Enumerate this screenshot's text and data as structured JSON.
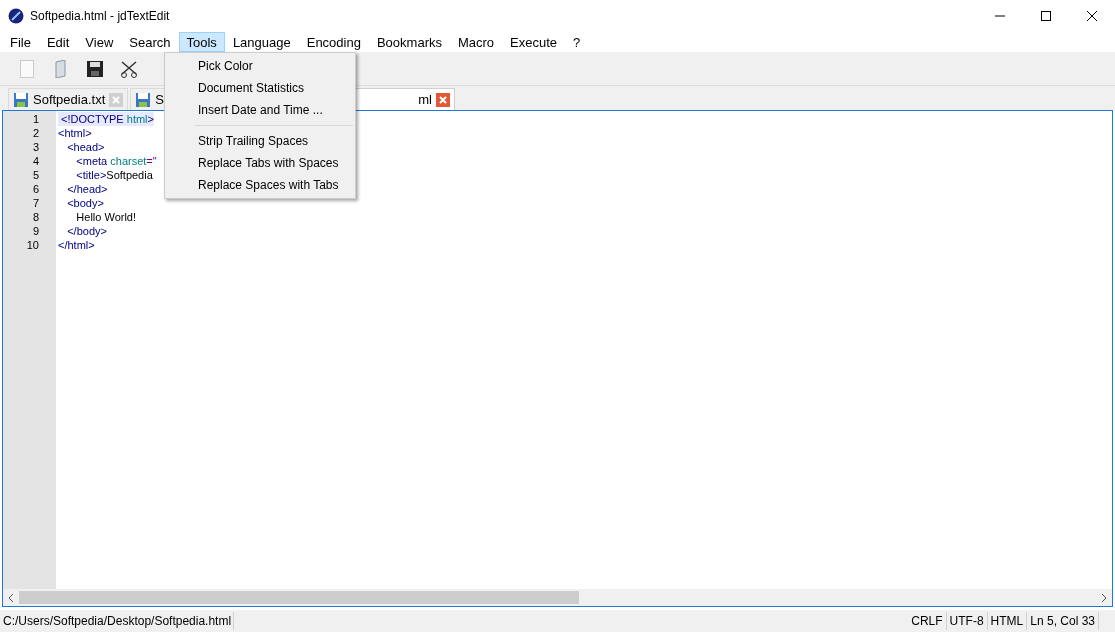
{
  "window": {
    "title": "Softpedia.html - jdTextEdit"
  },
  "menu": [
    {
      "label": "File",
      "selected": false
    },
    {
      "label": "Edit",
      "selected": false
    },
    {
      "label": "View",
      "selected": false
    },
    {
      "label": "Search",
      "selected": false
    },
    {
      "label": "Tools",
      "selected": true
    },
    {
      "label": "Language",
      "selected": false
    },
    {
      "label": "Encoding",
      "selected": false
    },
    {
      "label": "Bookmarks",
      "selected": false
    },
    {
      "label": "Macro",
      "selected": false
    },
    {
      "label": "Execute",
      "selected": false
    },
    {
      "label": "?",
      "selected": false
    }
  ],
  "dropdown": [
    {
      "kind": "item",
      "label": "Pick Color"
    },
    {
      "kind": "item",
      "label": "Document Statistics"
    },
    {
      "kind": "item",
      "label": "Insert Date and Time ..."
    },
    {
      "kind": "separator"
    },
    {
      "kind": "item",
      "label": "Strip Trailing Spaces"
    },
    {
      "kind": "item",
      "label": "Replace Tabs with Spaces"
    },
    {
      "kind": "item",
      "label": "Replace Spaces with Tabs"
    }
  ],
  "tabs": [
    {
      "label": "Softpedia.txt",
      "selected": false
    },
    {
      "label": "S",
      "selected": false
    },
    {
      "label": "ml",
      "selected": true
    }
  ],
  "code": [
    {
      "number": "1",
      "current": true,
      "tokens": [
        {
          "kind": "tag",
          "text": " <!DOCTYPE "
        },
        {
          "kind": "attr",
          "text": "html"
        },
        {
          "kind": "tag",
          "text": ">"
        }
      ]
    },
    {
      "number": "2",
      "current": false,
      "tokens": [
        {
          "kind": "tag",
          "text": "<html>"
        }
      ]
    },
    {
      "number": "3",
      "current": false,
      "tokens": [
        {
          "kind": "tag",
          "text": "   <head>"
        }
      ]
    },
    {
      "number": "4",
      "current": false,
      "tokens": [
        {
          "kind": "tag",
          "text": "      <meta "
        },
        {
          "kind": "attr",
          "text": "charset"
        },
        {
          "kind": "punct",
          "text": "=\""
        }
      ]
    },
    {
      "number": "5",
      "current": false,
      "tokens": [
        {
          "kind": "tag",
          "text": "      <title>"
        },
        {
          "kind": "text",
          "text": "Softpedia"
        }
      ]
    },
    {
      "number": "6",
      "current": false,
      "tokens": [
        {
          "kind": "tag",
          "text": "   </head>"
        }
      ]
    },
    {
      "number": "7",
      "current": false,
      "tokens": [
        {
          "kind": "tag",
          "text": "   <body>"
        }
      ]
    },
    {
      "number": "8",
      "current": false,
      "tokens": [
        {
          "kind": "text",
          "text": "      Hello World!"
        }
      ]
    },
    {
      "number": "9",
      "current": false,
      "tokens": [
        {
          "kind": "tag",
          "text": "   </body>"
        }
      ]
    },
    {
      "number": "10",
      "current": false,
      "tokens": [
        {
          "kind": "tag",
          "text": "</html>"
        }
      ]
    }
  ],
  "status_bar": {
    "path": "C:/Users/Softpedia/Desktop/Softpedia.html",
    "line_ending": "CRLF",
    "encoding": "UTF-8",
    "language": "HTML",
    "position": "Ln 5, Col 33"
  }
}
